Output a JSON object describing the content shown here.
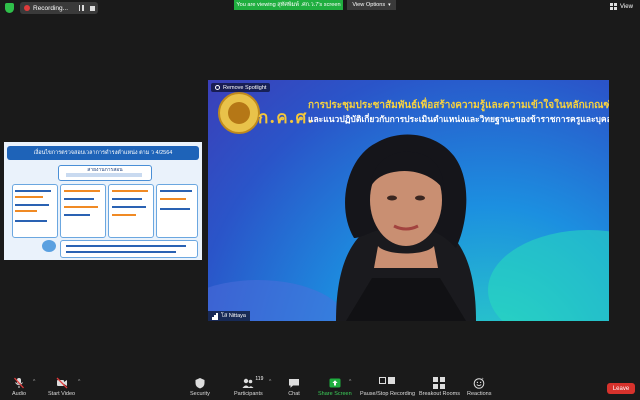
{
  "topbar": {
    "recording_label": "Recording...",
    "viewing_banner": "You are viewing สุทัศพิมพ์ .ศก.ว.7's screen",
    "view_options": "View Options",
    "view_label": "View"
  },
  "slide": {
    "title": "เงื่อนไขการตรวจสอบเวลาการดำรงตำแหน่ง ตาม ว 4/2564",
    "header": "สายงานการสอน"
  },
  "video": {
    "spotlight_label": "Remove Spotlight",
    "brand": "ก.ค.ศ.",
    "headline_1": "การประชุมประชาสัมพันธ์เพื่อสร้างความรู้และความเข้าใจในหลักเกณฑ์",
    "headline_2": "และแนวปฏิบัติเกี่ยวกับการประเมินตำแหน่งและวิทยฐานะของข้าราชการครูและบุคลากรทางการศึกษา",
    "participant_name": "โส Nittaya"
  },
  "toolbar": {
    "audio": "Audio",
    "start_video": "Start Video",
    "security": "Security",
    "participants": "Participants",
    "participant_count": "119",
    "chat": "Chat",
    "share_screen": "Share Screen",
    "pause_stop_recording": "Pause/Stop Recording",
    "breakout_rooms": "Breakout Rooms",
    "reactions": "Reactions",
    "leave": "Leave"
  },
  "colors": {
    "share_green": "#1fae3f",
    "leave_red": "#d7322c",
    "recording_red": "#e03b3b",
    "banner_yellow": "#f7d23e"
  }
}
